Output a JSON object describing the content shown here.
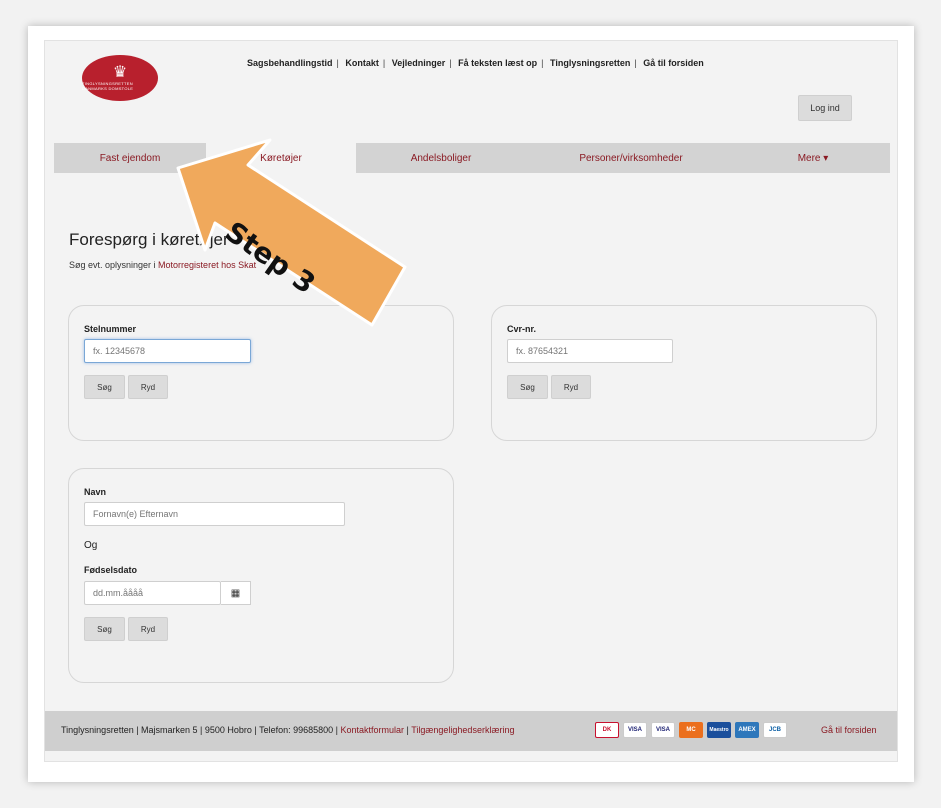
{
  "top_links": [
    "Sagsbehandlingstid",
    "Kontakt",
    "Vejledninger",
    "Få teksten læst op",
    "Tinglysningsretten",
    "Gå til forsiden"
  ],
  "login_label": "Log ind",
  "logo": {
    "icon": "crown-icon",
    "text": "TINGLYSNINGSRETTEN DANMARKS DOMSTOLE"
  },
  "nav": {
    "items": [
      "Fast ejendom",
      "Køretøjer",
      "Andelsboliger",
      "Personer/virksomheder",
      "Mere ▾"
    ],
    "active_index": 1
  },
  "page": {
    "heading": "Forespørg i køretøjer",
    "subtext_pre": "Søg evt. oplysninger i ",
    "subtext_link": "Motorregisteret hos Skat"
  },
  "stelnummer": {
    "label": "Stelnummer",
    "placeholder": "fx. 12345678",
    "search": "Søg",
    "clear": "Ryd"
  },
  "cvr": {
    "label": "Cvr-nr.",
    "placeholder": "fx. 87654321",
    "search": "Søg",
    "clear": "Ryd"
  },
  "person": {
    "name_label": "Navn",
    "name_placeholder": "Fornavn(e) Efternavn",
    "and_text": "Og",
    "dob_label": "Fødselsdato",
    "dob_placeholder": "dd.mm.åååå",
    "calendar_icon": "calendar-icon",
    "search": "Søg",
    "clear": "Ryd"
  },
  "footer": {
    "address": "Tinglysningsretten | Majsmarken 5 | 9500 Hobro | Telefon: 99685800 | ",
    "contact_link": "Kontaktformular",
    "sep": " | ",
    "access_link": "Tilgængelighedserklæring",
    "payment_cards": [
      "DK",
      "VISA",
      "VISA",
      "MC",
      "Maestro",
      "AMEX",
      "JCB"
    ],
    "home_link": "Gå til forsiden"
  },
  "annotation": {
    "text": "Step 3",
    "color": "#f0a95c"
  }
}
